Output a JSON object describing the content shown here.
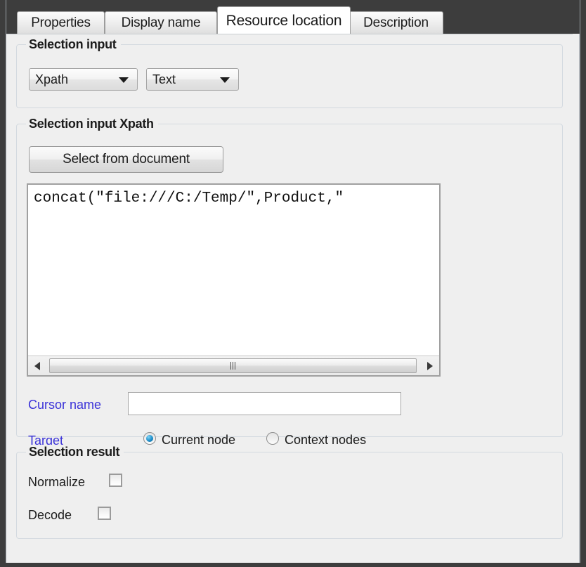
{
  "window": {
    "chrome_color": "#3d3d3d",
    "background_color": "#efefef"
  },
  "tabs": {
    "items": [
      {
        "label": "Properties",
        "selected": false
      },
      {
        "label": "Display name",
        "selected": false
      },
      {
        "label": "Resource location",
        "selected": true
      },
      {
        "label": "Description",
        "selected": false
      }
    ]
  },
  "selection_input": {
    "title": "Selection input",
    "type_combo": {
      "value": "Xpath",
      "arrow_icon": "chevron-down-icon"
    },
    "format_combo": {
      "value": "Text",
      "arrow_icon": "chevron-down-icon"
    }
  },
  "selection_input_xpath": {
    "title": "Selection input Xpath",
    "select_button": "Select from document",
    "expression": "concat(\"file:///C:/Temp/\",Product,\"",
    "scrollbar": {
      "left_arrow_icon": "triangle-left-icon",
      "right_arrow_icon": "triangle-right-icon",
      "grip_icon": "grip-lines-icon"
    },
    "cursor_name": {
      "label": "Cursor name",
      "value": "",
      "placeholder": ""
    },
    "target": {
      "label": "Target",
      "options": [
        {
          "label": "Current node",
          "selected": true
        },
        {
          "label": "Context nodes",
          "selected": false
        }
      ]
    },
    "label_color": "#3a32d8"
  },
  "selection_result": {
    "title": "Selection result",
    "options": [
      {
        "label": "Normalize",
        "checked": false
      },
      {
        "label": "Decode",
        "checked": false
      }
    ]
  }
}
